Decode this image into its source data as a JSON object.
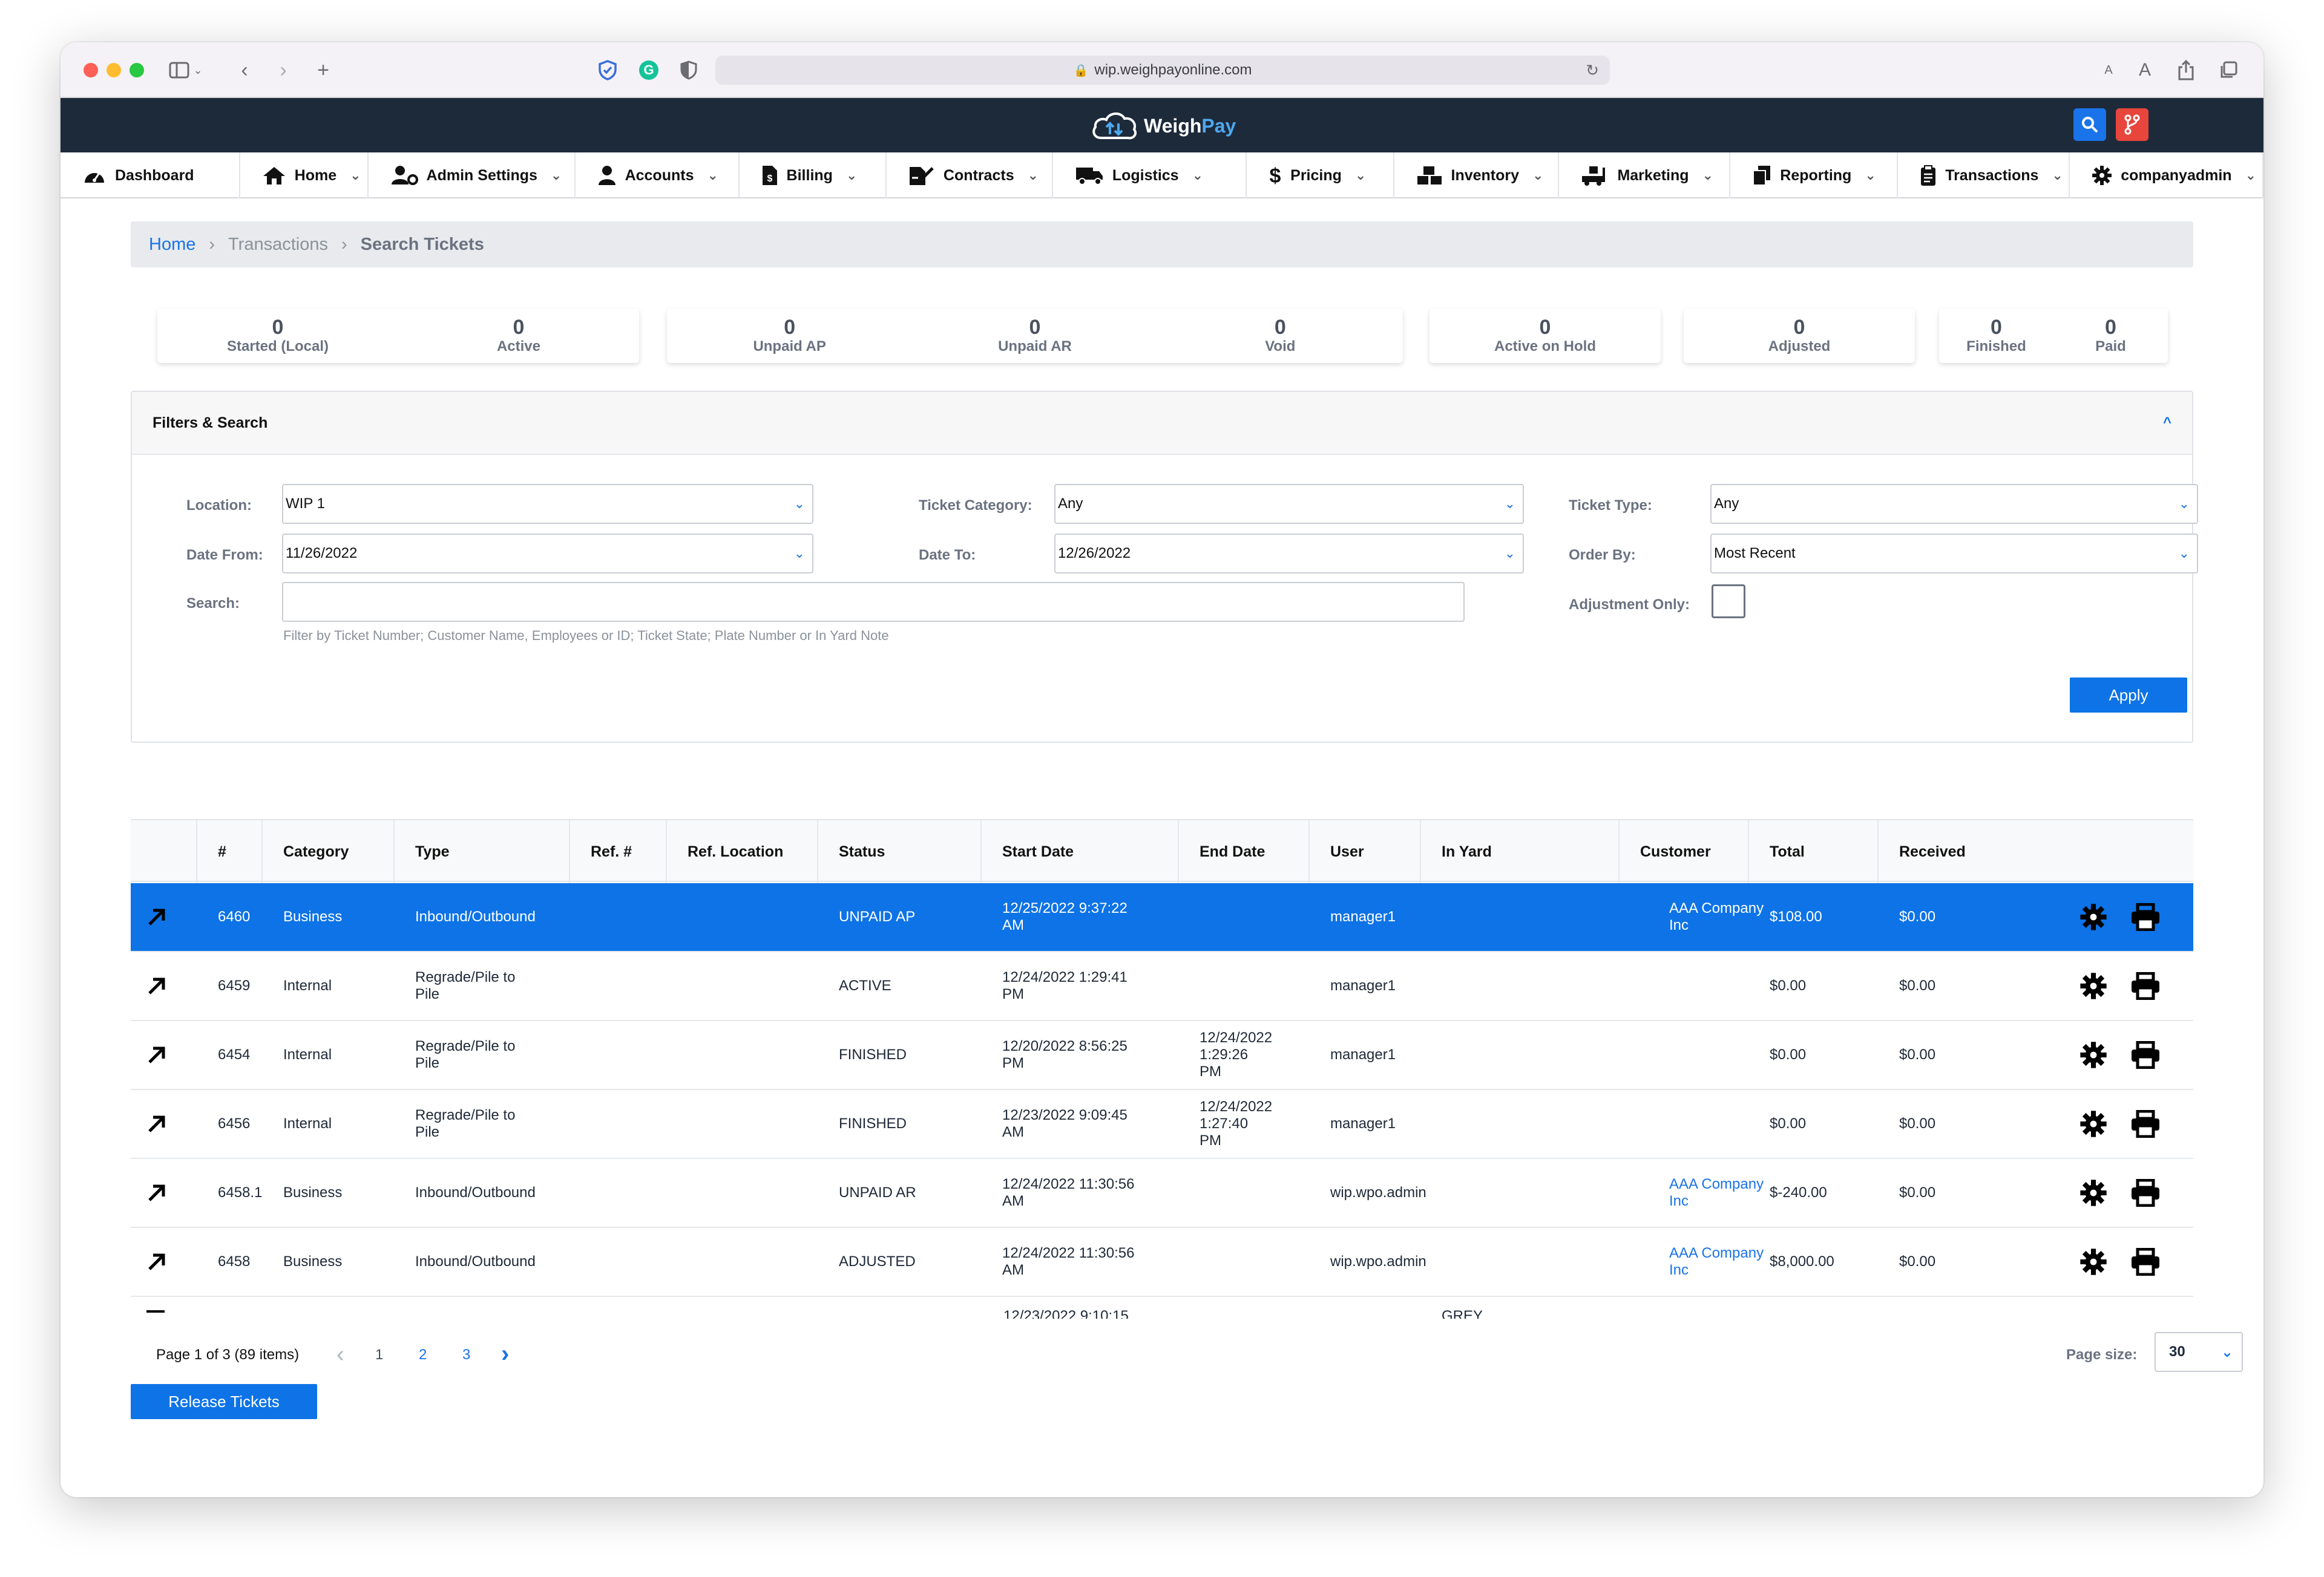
{
  "browser": {
    "url": "wip.weighpayonline.com"
  },
  "app": {
    "logo_main": "Weigh",
    "logo_accent": "Pay"
  },
  "nav": [
    {
      "id": "dashboard",
      "label": "Dashboard",
      "icon": "gauge-icon",
      "has_menu": false
    },
    {
      "id": "home",
      "label": "Home",
      "icon": "house-icon",
      "has_menu": true
    },
    {
      "id": "admin-settings",
      "label": "Admin Settings",
      "icon": "user-gear-icon",
      "has_menu": true
    },
    {
      "id": "accounts",
      "label": "Accounts",
      "icon": "user-icon",
      "has_menu": true
    },
    {
      "id": "billing",
      "label": "Billing",
      "icon": "invoice-icon",
      "has_menu": true
    },
    {
      "id": "contracts",
      "label": "Contracts",
      "icon": "signature-icon",
      "has_menu": true
    },
    {
      "id": "logistics",
      "label": "Logistics",
      "icon": "truck-icon",
      "has_menu": true
    },
    {
      "id": "pricing",
      "label": "Pricing",
      "icon": "dollar-icon",
      "has_menu": true
    },
    {
      "id": "inventory",
      "label": "Inventory",
      "icon": "boxes-icon",
      "has_menu": true
    },
    {
      "id": "marketing",
      "label": "Marketing",
      "icon": "truck-loading-icon",
      "has_menu": true
    },
    {
      "id": "reporting",
      "label": "Reporting",
      "icon": "copy-icon",
      "has_menu": true
    },
    {
      "id": "transactions",
      "label": "Transactions",
      "icon": "clipboard-icon",
      "has_menu": true
    },
    {
      "id": "companyadmin",
      "label": "companyadmin",
      "icon": "gear-icon",
      "has_menu": true
    }
  ],
  "breadcrumb": {
    "home": "Home",
    "sep1": "›",
    "section": "Transactions",
    "sep2": "›",
    "current": "Search Tickets"
  },
  "stats": [
    {
      "value": "0",
      "label": "Started (Local)"
    },
    {
      "value": "0",
      "label": "Active"
    },
    {
      "value": "0",
      "label": "Unpaid AP"
    },
    {
      "value": "0",
      "label": "Unpaid AR"
    },
    {
      "value": "0",
      "label": "Void"
    },
    {
      "value": "0",
      "label": "Active on Hold"
    },
    {
      "value": "0",
      "label": "Adjusted"
    },
    {
      "value": "0",
      "label": "Finished"
    },
    {
      "value": "0",
      "label": "Paid"
    }
  ],
  "filters": {
    "title": "Filters & Search",
    "collapse_glyph": "^",
    "location_label": "Location:",
    "location_value": "WIP 1",
    "ticket_category_label": "Ticket Category:",
    "ticket_category_value": "Any",
    "ticket_type_label": "Ticket Type:",
    "ticket_type_value": "Any",
    "date_from_label": "Date From:",
    "date_from_value": "11/26/2022",
    "date_to_label": "Date To:",
    "date_to_value": "12/26/2022",
    "order_by_label": "Order By:",
    "order_by_value": "Most Recent",
    "search_label": "Search:",
    "search_value": "",
    "search_hint": "Filter by Ticket Number; Customer Name, Employees or ID; Ticket State; Plate Number or In Yard Note",
    "adjustment_only_label": "Adjustment Only:",
    "adjustment_only_checked": false,
    "apply_label": "Apply"
  },
  "table": {
    "columns": [
      "#",
      "Category",
      "Type",
      "Ref. #",
      "Ref. Location",
      "Status",
      "Start Date",
      "End Date",
      "User",
      "In Yard",
      "Customer",
      "Total",
      "Received"
    ],
    "rows": [
      {
        "num": "6460",
        "category": "Business",
        "type": "Inbound/Outbound",
        "ref": "",
        "ref_location": "",
        "status": "UNPAID AP",
        "start_1": "12/25/2022 9:37:22",
        "start_2": "AM",
        "end_1": "",
        "end_2": "",
        "user": "manager1",
        "in_yard": "",
        "customer": "AAA Company Inc",
        "total": "$108.00",
        "received": "$0.00",
        "selected": true
      },
      {
        "num": "6459",
        "category": "Internal",
        "type": "Regrade/Pile to Pile",
        "ref": "",
        "ref_location": "",
        "status": "ACTIVE",
        "start_1": "12/24/2022 1:29:41",
        "start_2": "PM",
        "end_1": "",
        "end_2": "",
        "user": "manager1",
        "in_yard": "",
        "customer": "",
        "total": "$0.00",
        "received": "$0.00",
        "selected": false
      },
      {
        "num": "6454",
        "category": "Internal",
        "type": "Regrade/Pile to Pile",
        "ref": "",
        "ref_location": "",
        "status": "FINISHED",
        "start_1": "12/20/2022 8:56:25",
        "start_2": "PM",
        "end_1": "12/24/2022 1:29:26",
        "end_2": "PM",
        "user": "manager1",
        "in_yard": "",
        "customer": "",
        "total": "$0.00",
        "received": "$0.00",
        "selected": false
      },
      {
        "num": "6456",
        "category": "Internal",
        "type": "Regrade/Pile to Pile",
        "ref": "",
        "ref_location": "",
        "status": "FINISHED",
        "start_1": "12/23/2022 9:09:45",
        "start_2": "AM",
        "end_1": "12/24/2022 1:27:40",
        "end_2": "PM",
        "user": "manager1",
        "in_yard": "",
        "customer": "",
        "total": "$0.00",
        "received": "$0.00",
        "selected": false
      },
      {
        "num": "6458.1",
        "category": "Business",
        "type": "Inbound/Outbound",
        "ref": "",
        "ref_location": "",
        "status": "UNPAID AR",
        "start_1": "12/24/2022 11:30:56",
        "start_2": "AM",
        "end_1": "",
        "end_2": "",
        "user": "wip.wpo.admin",
        "in_yard": "",
        "customer": "AAA Company Inc",
        "total": "$-240.00",
        "received": "$0.00",
        "selected": false
      },
      {
        "num": "6458",
        "category": "Business",
        "type": "Inbound/Outbound",
        "ref": "",
        "ref_location": "",
        "status": "ADJUSTED",
        "start_1": "12/24/2022 11:30:56",
        "start_2": "AM",
        "end_1": "",
        "end_2": "",
        "user": "wip.wpo.admin",
        "in_yard": "",
        "customer": "AAA Company Inc",
        "total": "$8,000.00",
        "received": "$0.00",
        "selected": false
      }
    ],
    "partial_row": {
      "start_1": "12/23/2022 9:10:15",
      "in_yard": "GREY"
    }
  },
  "pager": {
    "summary": "Page 1 of 3 (89 items)",
    "pages": [
      "1",
      "2",
      "3"
    ],
    "current_page": "1",
    "page_size_label": "Page size:",
    "page_size_value": "30"
  },
  "release_label": "Release Tickets",
  "colors": {
    "primary": "#0d73e6",
    "topbar": "#1d2a3a",
    "link": "#1a73e8"
  }
}
